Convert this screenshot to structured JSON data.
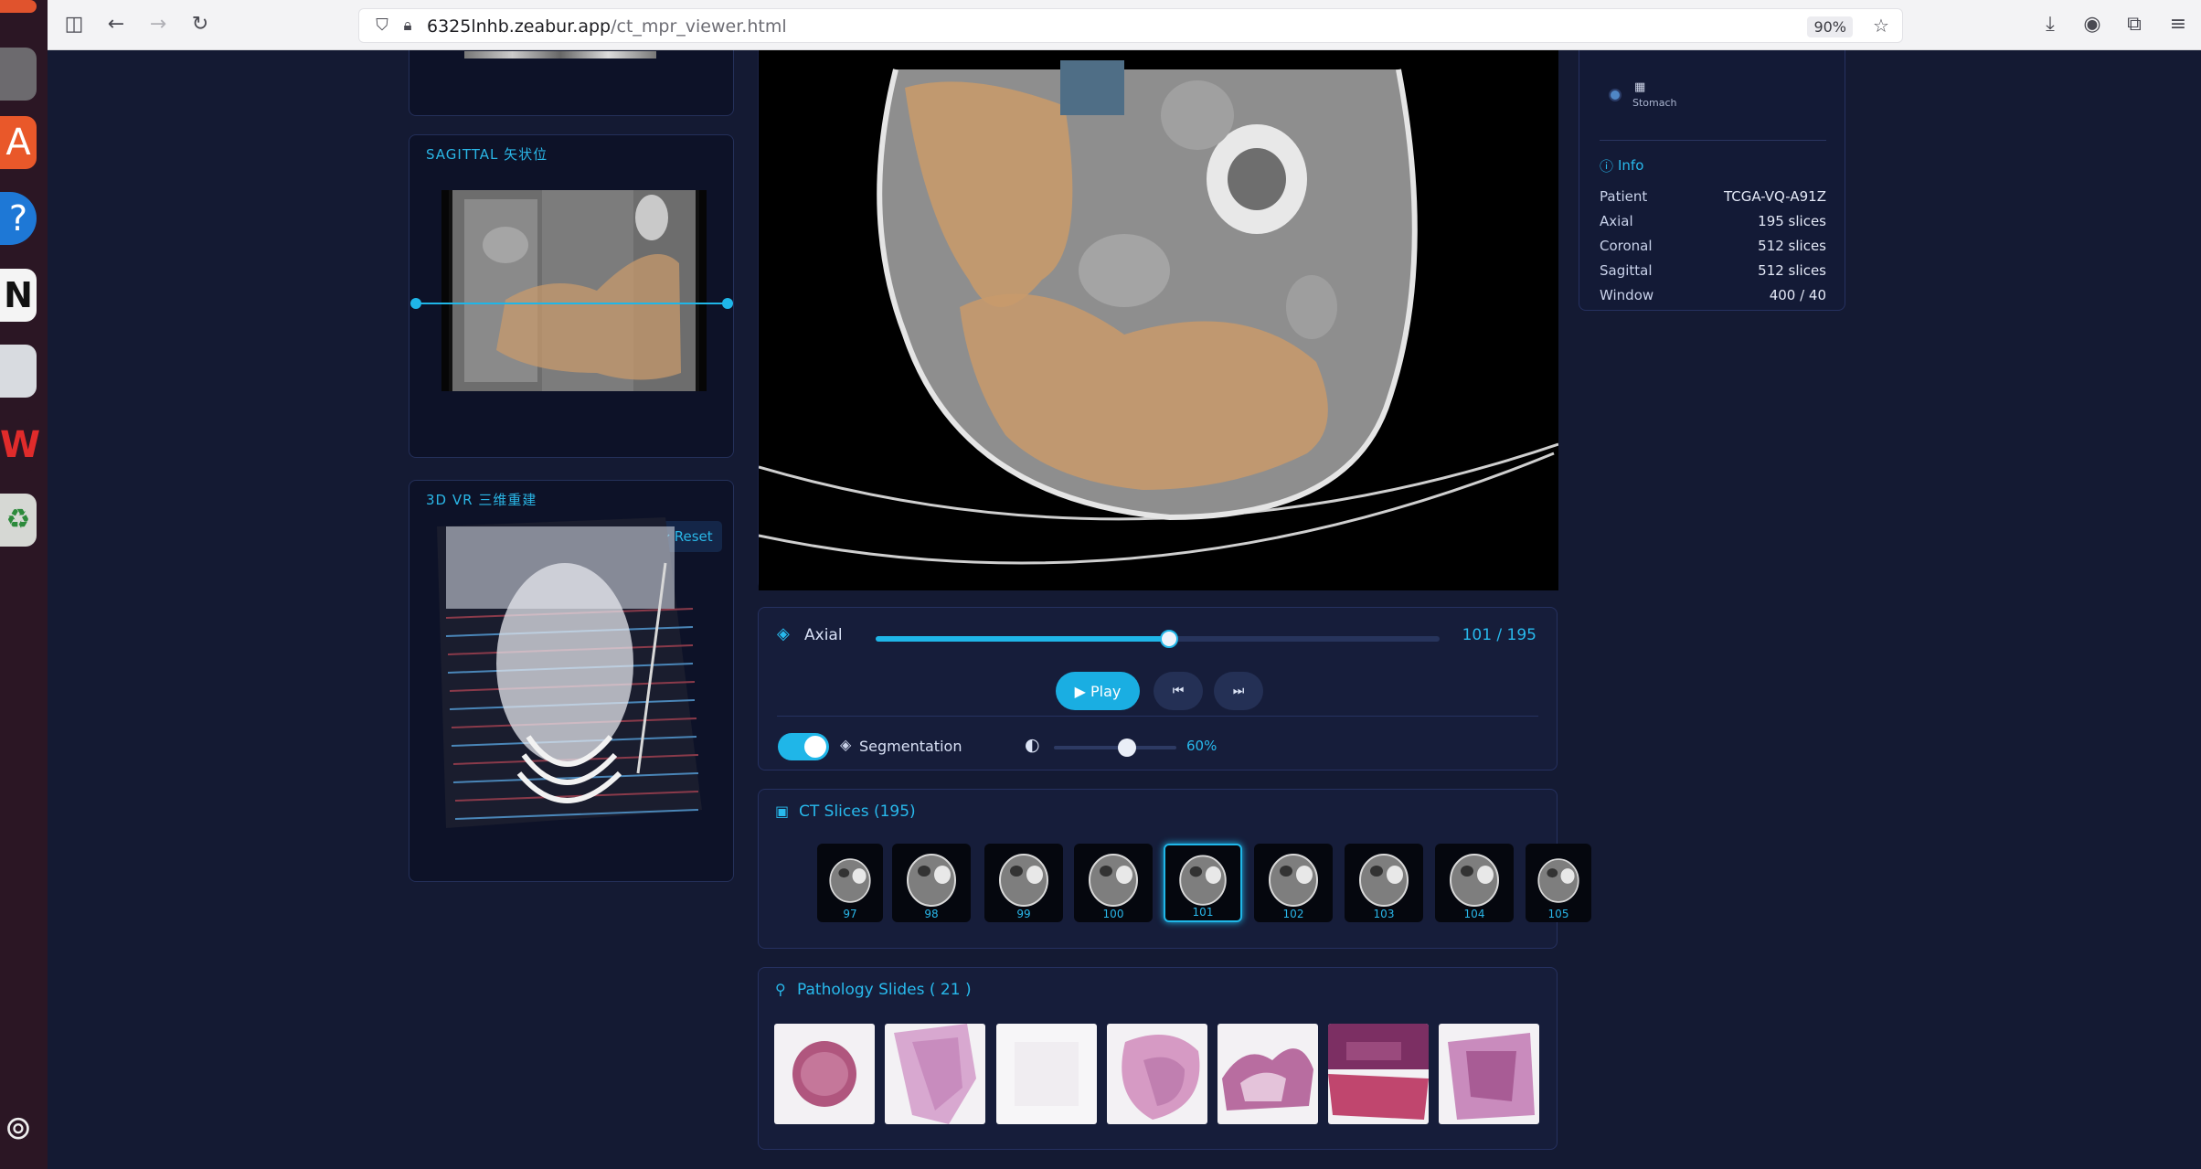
{
  "browser": {
    "url_host": "6325lnhb.zeabur.app",
    "url_path": "/ct_mpr_viewer.html",
    "zoom": "90%"
  },
  "sidebar_panels": {
    "sagittal_label": "SAGITTAL 矢状位",
    "vr_label": "3D VR 三维重建",
    "reset_label": "Reset"
  },
  "controls": {
    "plane_label": "Axial",
    "slice_counter": "101 / 195",
    "slider_fraction": 0.52,
    "play_label": "Play",
    "segmentation_label": "Segmentation",
    "segmentation_on": true,
    "opacity_value": "60%",
    "opacity_fraction": 0.6
  },
  "ct_slices": {
    "title": "CT Slices (195)",
    "items": [
      "97",
      "98",
      "99",
      "100",
      "101",
      "102",
      "103",
      "104",
      "105"
    ],
    "active": "101"
  },
  "pathology": {
    "title": "Pathology Slides ( 21 )"
  },
  "right_panel": {
    "organ_label": "Stomach",
    "info_title": "Info",
    "rows": [
      {
        "key": "Patient",
        "value": "TCGA-VQ-A91Z"
      },
      {
        "key": "Axial",
        "value": "195 slices"
      },
      {
        "key": "Coronal",
        "value": "512 slices"
      },
      {
        "key": "Sagittal",
        "value": "512 slices"
      },
      {
        "key": "Window",
        "value": "400 / 40"
      }
    ]
  },
  "colors": {
    "accent": "#1fb6e8",
    "segmentation": "#c79a6c",
    "panel_bg": "#0d1228",
    "page_bg": "#141a33"
  }
}
